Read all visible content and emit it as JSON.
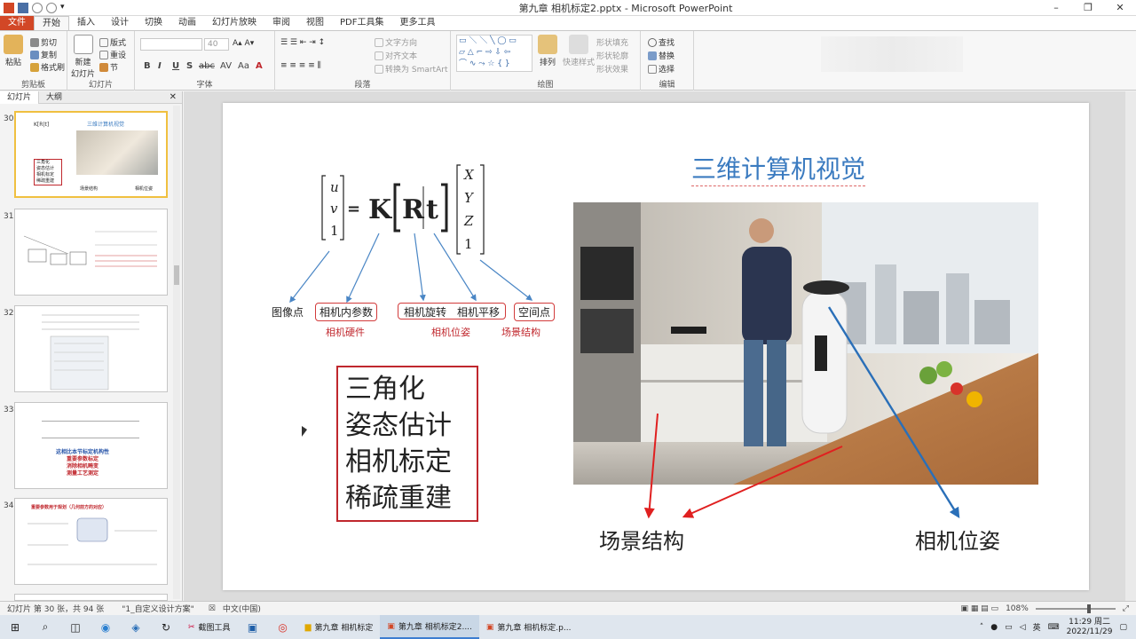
{
  "window": {
    "title": "第九章 相机标定2.pptx - Microsoft PowerPoint",
    "controls": [
      "–",
      "❐",
      "✕"
    ]
  },
  "tabs": [
    "文件",
    "开始",
    "插入",
    "设计",
    "切换",
    "动画",
    "幻灯片放映",
    "审阅",
    "视图",
    "PDF工具集",
    "更多工具"
  ],
  "ribbon": {
    "clipboard": {
      "paste": "粘贴",
      "cut": "剪切",
      "copy": "复制",
      "format_painter": "格式刷",
      "label": "剪贴板"
    },
    "slides": {
      "new_slide": "新建",
      "new_slide2": "幻灯片",
      "layout": "版式",
      "reset": "重设",
      "section": "节",
      "label": "幻灯片"
    },
    "font": {
      "size": "40",
      "label": "字体",
      "bold": "B",
      "italic": "I",
      "underline": "U",
      "shadow": "S",
      "strike": "abc",
      "spacing": "AV",
      "case": "Aa",
      "color": "A"
    },
    "paragraph": {
      "text_direction": "文字方向",
      "align_text": "对齐文本",
      "smartart": "转换为 SmartArt",
      "label": "段落"
    },
    "drawing": {
      "arrange": "排列",
      "quick_styles": "快速样式",
      "shape_fill": "形状填充",
      "shape_outline": "形状轮廓",
      "shape_effects": "形状效果",
      "label": "绘图"
    },
    "editing": {
      "find": "查找",
      "replace": "替换",
      "select": "选择",
      "label": "编辑"
    }
  },
  "leftpanel": {
    "tab_slides": "幻灯片",
    "tab_outline": "大纲",
    "close": "✕",
    "thumbs": [
      {
        "num": "30",
        "title": "三维计算机视觉",
        "lines": [
          "三角化",
          "姿态估计",
          "相机标定",
          "稀疏重建"
        ],
        "caption_left": "场景结构",
        "caption_right": "相机位姿"
      },
      {
        "num": "31"
      },
      {
        "num": "32"
      },
      {
        "num": "33",
        "title": "这相比本节标定机构性",
        "lines": [
          "重要参数标定",
          "消除相机畸变",
          "测量工艺测定"
        ]
      },
      {
        "num": "34",
        "title": "重要参数用于规划（几何前方的对应）"
      }
    ]
  },
  "slide": {
    "title": "三维计算机视觉",
    "formula": {
      "left": [
        "u",
        "v",
        "1"
      ],
      "eq": "=",
      "K": "K",
      "R": "R",
      "t": "t",
      "right": [
        "X",
        "Y",
        "Z",
        "1"
      ]
    },
    "labels": {
      "image_point": "图像点",
      "intrinsics": "相机内参数",
      "hardware": "相机硬件",
      "rotation": "相机旋转",
      "translation": "相机平移",
      "pose": "相机位姿",
      "space_point": "空间点",
      "scene": "场景结构"
    },
    "box_lines": [
      "三角化",
      "姿态估计",
      "相机标定",
      "稀疏重建"
    ],
    "bottom_left": "场景结构",
    "bottom_right": "相机位姿"
  },
  "status": {
    "slide_info": "幻灯片 第 30 张，共 94 张",
    "theme": "\"1_自定义设计方案\"",
    "lang": "中文(中国)",
    "zoom": "108%"
  },
  "taskbar": {
    "apps": [
      "截图工具",
      "第九章 相机标定",
      "第九章 相机标定2....",
      "第九章 相机标定.p..."
    ],
    "ime": "英",
    "time": "11:29 周二",
    "date": "2022/11/29"
  },
  "colors": {
    "accent": "#d24726",
    "title_blue": "#3b7bc0",
    "red": "#c0272d",
    "arrow_blue": "#2a6fb8"
  }
}
